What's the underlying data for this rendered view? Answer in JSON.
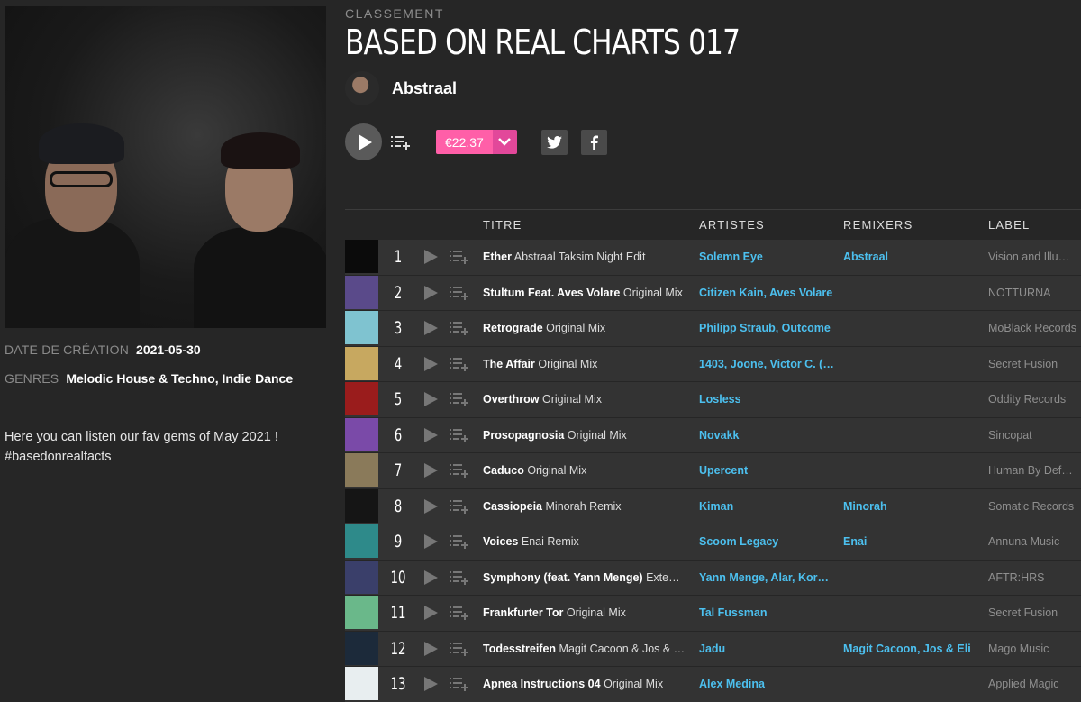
{
  "chart": {
    "eyebrow": "CLASSEMENT",
    "title": "BASED ON REAL CHARTS 017",
    "artist": "Abstraal",
    "price": "€22.37",
    "created_label": "DATE DE CRÉATION",
    "created_value": "2021-05-30",
    "genres_label": "GENRES",
    "genres_value": "Melodic House & Techno, Indie Dance",
    "description_line1": "Here you can listen our fav gems of May 2021 !",
    "description_line2": "#basedonrealfacts"
  },
  "icons": {
    "play": "play-icon",
    "queue": "add-to-queue-icon",
    "dropdown": "chevron-down-icon",
    "twitter": "twitter-icon",
    "facebook": "facebook-icon"
  },
  "colors": {
    "accent_pink": "#ff5fa8",
    "link_blue": "#4cc0ef",
    "row_bg": "#333333",
    "page_bg": "#262626"
  },
  "table": {
    "headers": {
      "title": "TITRE",
      "artists": "ARTISTES",
      "remixers": "REMIXERS",
      "label": "LABEL"
    },
    "rows": [
      {
        "num": "1",
        "name": "Ether",
        "mix": "Abstraal Taksim Night Edit",
        "artists": "Solemn Eye",
        "remixers": "Abstraal",
        "label": "Vision and Illu…",
        "thumb": "#0b0b0b"
      },
      {
        "num": "2",
        "name": "Stultum Feat. Aves Volare",
        "mix": "Original Mix",
        "artists": "Citizen Kain, Aves Volare",
        "remixers": "",
        "label": "NOTTURNA",
        "thumb": "#5a4a8a"
      },
      {
        "num": "3",
        "name": "Retrograde",
        "mix": "Original Mix",
        "artists": "Philipp Straub, Outcome",
        "remixers": "",
        "label": "MoBlack Records",
        "thumb": "#7fc3d0"
      },
      {
        "num": "4",
        "name": "The Affair",
        "mix": "Original Mix",
        "artists": "1403, Joone, Victor C. (…",
        "remixers": "",
        "label": "Secret Fusion",
        "thumb": "#c7a860"
      },
      {
        "num": "5",
        "name": "Overthrow",
        "mix": "Original Mix",
        "artists": "Losless",
        "remixers": "",
        "label": "Oddity Records",
        "thumb": "#9a1c1c"
      },
      {
        "num": "6",
        "name": "Prosopagnosia",
        "mix": "Original Mix",
        "artists": "Novakk",
        "remixers": "",
        "label": "Sincopat",
        "thumb": "#7a4aa8"
      },
      {
        "num": "7",
        "name": "Caduco",
        "mix": "Original Mix",
        "artists": "Upercent",
        "remixers": "",
        "label": "Human By Def…",
        "thumb": "#8a7a5a"
      },
      {
        "num": "8",
        "name": "Cassiopeia",
        "mix": "Minorah Remix",
        "artists": "Kiman",
        "remixers": "Minorah",
        "label": "Somatic Records",
        "thumb": "#151515"
      },
      {
        "num": "9",
        "name": "Voices",
        "mix": "Enai Remix",
        "artists": "Scoom Legacy",
        "remixers": "Enai",
        "label": "Annuna Music",
        "thumb": "#2e8a8a"
      },
      {
        "num": "10",
        "name": "Symphony (feat. Yann Menge)",
        "mix": "Exte…",
        "artists": "Yann Menge, Alar, Korol…",
        "remixers": "",
        "label": "AFTR:HRS",
        "thumb": "#3a3f6a"
      },
      {
        "num": "11",
        "name": "Frankfurter Tor",
        "mix": "Original Mix",
        "artists": "Tal Fussman",
        "remixers": "",
        "label": "Secret Fusion",
        "thumb": "#6ab88a"
      },
      {
        "num": "12",
        "name": "Todesstreifen",
        "mix": "Magit Cacoon & Jos & …",
        "artists": "Jadu",
        "remixers": "Magit Cacoon, Jos & Eli",
        "label": "Mago Music",
        "thumb": "#1c2a3a"
      },
      {
        "num": "13",
        "name": "Apnea Instructions 04",
        "mix": "Original Mix",
        "artists": "Alex Medina",
        "remixers": "",
        "label": "Applied Magic",
        "thumb": "#e8eef0"
      }
    ]
  }
}
